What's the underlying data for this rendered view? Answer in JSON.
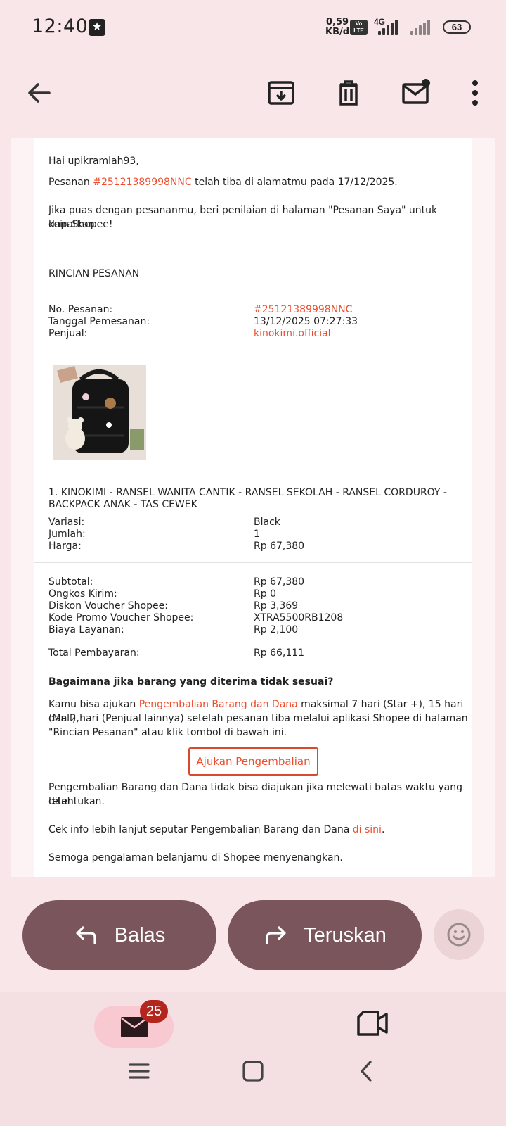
{
  "status_bar": {
    "time": "12:40",
    "net_speed_value": "0,59",
    "net_speed_unit": "KB/d",
    "volte": "Vo LTE",
    "network": "4G",
    "battery": "63"
  },
  "app_bar": {
    "back_icon": "arrow-left-icon",
    "actions": [
      "archive-icon",
      "delete-icon",
      "mark-unread-icon",
      "more-vert-icon"
    ]
  },
  "email": {
    "greeting": "Hai upikramlah93,",
    "arrived_prefix": "Pesanan ",
    "order_link": "#25121389998NNC",
    "arrived_suffix": " telah tiba di alamatmu pada 17/12/2025.",
    "rate_text_line1": "Jika puas dengan pesananmu, beri penilaian di halaman \"Pesanan Saya\" untuk dapatkan",
    "rate_text_line2": "koin Shopee!",
    "section_title": "RINCIAN PESANAN",
    "order_info": [
      {
        "label": "No. Pesanan:",
        "value": "#25121389998NNC"
      },
      {
        "label": "Tanggal Pemesanan:",
        "value": "13/12/2025 07:27:33"
      },
      {
        "label": "Penjual:",
        "value": "kinokimi.official"
      }
    ],
    "product_title_line1": "1. KINOKIMI - RANSEL WANITA CANTIK - RANSEL SEKOLAH - RANSEL CORDUROY -",
    "product_title_line2": "BACKPACK ANAK - TAS CEWEK",
    "product_details": [
      {
        "label": "Variasi:",
        "value": "Black"
      },
      {
        "label": "Jumlah:",
        "value": "1"
      },
      {
        "label": "Harga:",
        "value": "Rp 67,380"
      }
    ],
    "totals": [
      {
        "label": "Subtotal:",
        "value": "Rp 67,380"
      },
      {
        "label": "Ongkos Kirim:",
        "value": "Rp 0"
      },
      {
        "label": "Diskon Voucher Shopee:",
        "value": "Rp 3,369"
      },
      {
        "label": "Kode Promo Voucher Shopee:",
        "value": "XTRA5500RB1208"
      },
      {
        "label": "Biaya Layanan:",
        "value": "Rp 2,100"
      }
    ],
    "total_label": "Total Pembayaran:",
    "total_value": "Rp 66,111",
    "return_heading": "Bagaimana jika barang yang diterima tidak sesuai?",
    "return_p1_prefix": "Kamu bisa ajukan ",
    "return_p1_link": "Pengembalian Barang dan Dana",
    "return_p1_suffix": " maksimal 7 hari (Star +), 15 hari (Mall),",
    "return_p1_line2": "dan 2 hari (Penjual lainnya) setelah pesanan tiba melalui aplikasi Shopee di halaman",
    "return_p1_line3": "\"Rincian Pesanan\" atau klik tombol di bawah ini.",
    "return_button": "Ajukan Pengembalian",
    "return_p2_line1": "Pengembalian Barang dan Dana tidak bisa diajukan jika melewati batas waktu yang telah",
    "return_p2_line2": "ditentukan.",
    "info_prefix": "Cek info lebih lanjut seputar Pengembalian Barang dan Dana ",
    "info_link": "di sini",
    "info_suffix": ".",
    "closing": "Semoga pengalaman belanjamu di Shopee menyenangkan."
  },
  "actions": {
    "reply": "Balas",
    "forward": "Teruskan"
  },
  "bottom_nav": {
    "mail_badge": "25"
  },
  "colors": {
    "accent_orange": "#ee4d2d",
    "action_button": "#7a555c",
    "background": "#f9e6e8",
    "badge": "#b3261e"
  }
}
